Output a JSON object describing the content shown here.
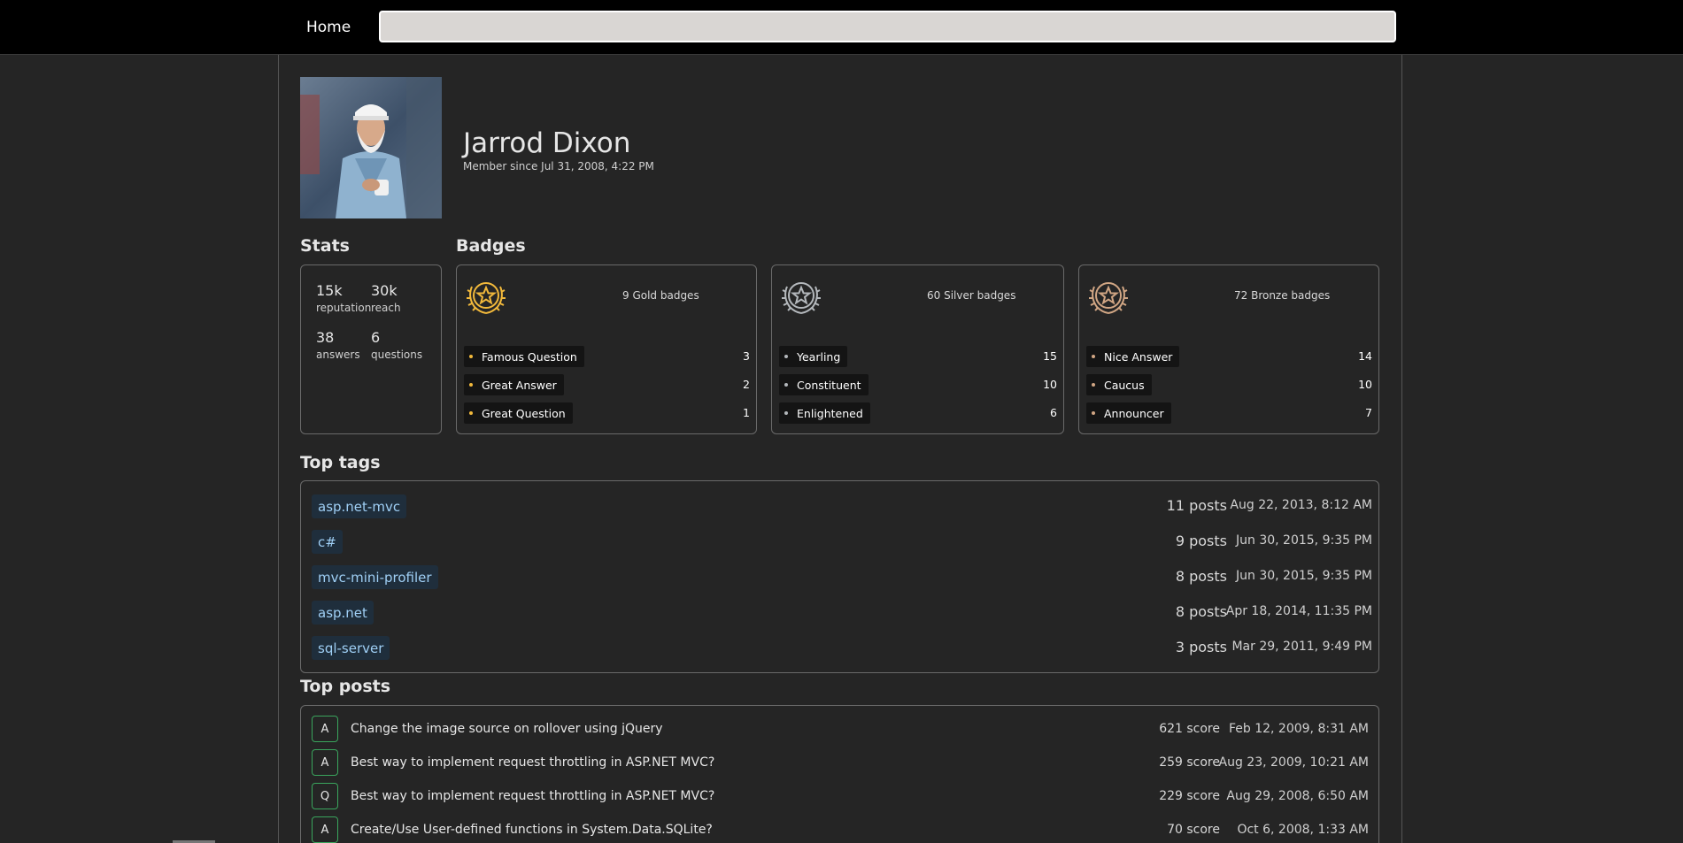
{
  "nav": {
    "home_label": "Home",
    "search_value": ""
  },
  "profile": {
    "name": "Jarrod Dixon",
    "member_since": "Member since Jul 31, 2008, 4:22 PM"
  },
  "stats": {
    "heading": "Stats",
    "items": [
      {
        "value": "15k",
        "label": "reputation"
      },
      {
        "value": "30k",
        "label": "reach"
      },
      {
        "value": "38",
        "label": "answers"
      },
      {
        "value": "6",
        "label": "questions"
      }
    ]
  },
  "badges": {
    "heading": "Badges",
    "groups": [
      {
        "tier": "gold",
        "color": "#f2b93b",
        "count_label": "9 Gold badges",
        "items": [
          {
            "name": "Famous Question",
            "count": "3"
          },
          {
            "name": "Great Answer",
            "count": "2"
          },
          {
            "name": "Great Question",
            "count": "1"
          }
        ]
      },
      {
        "tier": "silver",
        "color": "#b4b8bc",
        "count_label": "60 Silver badges",
        "items": [
          {
            "name": "Yearling",
            "count": "15"
          },
          {
            "name": "Constituent",
            "count": "10"
          },
          {
            "name": "Enlightened",
            "count": "6"
          }
        ]
      },
      {
        "tier": "bronze",
        "color": "#d1a684",
        "count_label": "72 Bronze badges",
        "items": [
          {
            "name": "Nice Answer",
            "count": "14"
          },
          {
            "name": "Caucus",
            "count": "10"
          },
          {
            "name": "Announcer",
            "count": "7"
          }
        ]
      }
    ]
  },
  "top_tags": {
    "heading": "Top tags",
    "items": [
      {
        "tag": "asp.net-mvc",
        "posts": "11 posts",
        "date": "Aug 22, 2013, 8:12 AM"
      },
      {
        "tag": "c#",
        "posts": "9 posts",
        "date": "Jun 30, 2015, 9:35 PM"
      },
      {
        "tag": "mvc-mini-profiler",
        "posts": "8 posts",
        "date": "Jun 30, 2015, 9:35 PM"
      },
      {
        "tag": "asp.net",
        "posts": "8 posts",
        "date": "Apr 18, 2014, 11:35 PM"
      },
      {
        "tag": "sql-server",
        "posts": "3 posts",
        "date": "Mar 29, 2011, 9:49 PM"
      }
    ]
  },
  "top_posts": {
    "heading": "Top posts",
    "items": [
      {
        "type": "A",
        "title": "Change the image source on rollover using jQuery",
        "score": "621 score",
        "date": "Feb 12, 2009, 8:31 AM"
      },
      {
        "type": "A",
        "title": "Best way to implement request throttling in ASP.NET MVC?",
        "score": "259 score",
        "date": "Aug 23, 2009, 10:21 AM"
      },
      {
        "type": "Q",
        "title": "Best way to implement request throttling in ASP.NET MVC?",
        "score": "229 score",
        "date": "Aug 29, 2008, 6:50 AM"
      },
      {
        "type": "A",
        "title": "Create/Use User-defined functions in System.Data.SQLite?",
        "score": "70 score",
        "date": "Oct 6, 2008, 1:33 AM"
      }
    ]
  }
}
